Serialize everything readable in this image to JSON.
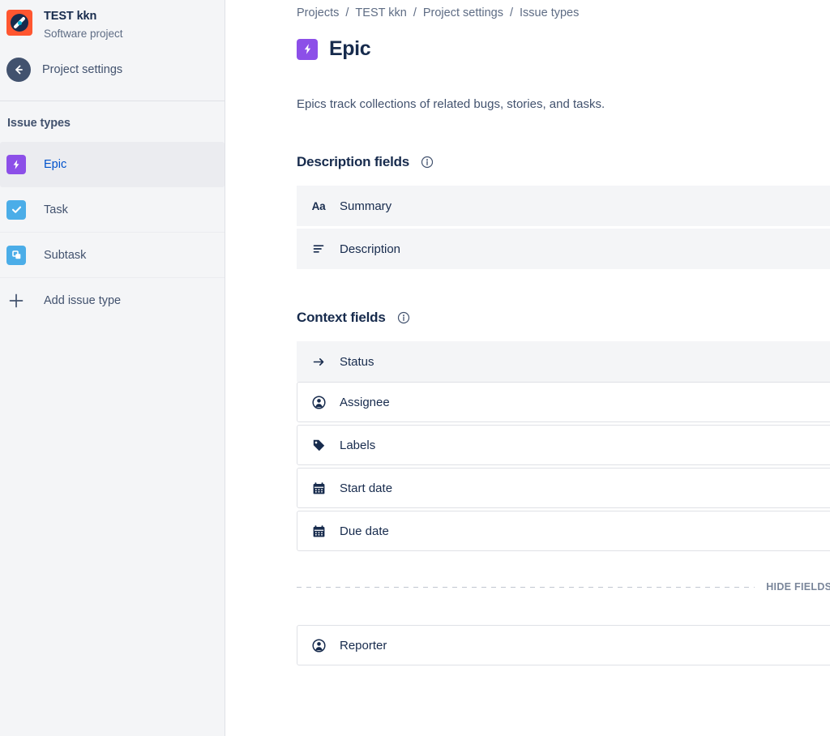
{
  "sidebar": {
    "project": {
      "name": "TEST kkn",
      "type": "Software project",
      "avatar_icon": "project-avatar-icon",
      "avatar_bg": "#FF5630"
    },
    "back_nav": {
      "label": "Project settings",
      "icon": "back-arrow-icon"
    },
    "section_title": "Issue types",
    "issue_types": [
      {
        "label": "Epic",
        "icon": "epic-bolt-icon",
        "color": "#8C4FE8",
        "selected": true
      },
      {
        "label": "Task",
        "icon": "task-check-icon",
        "color": "#4BADE8",
        "selected": false
      },
      {
        "label": "Subtask",
        "icon": "subtask-squares-icon",
        "color": "#4BADE8",
        "selected": false
      }
    ],
    "add_issue_type": {
      "label": "Add issue type",
      "icon": "plus-icon"
    }
  },
  "main": {
    "breadcrumb": [
      {
        "label": "Projects"
      },
      {
        "label": "TEST kkn"
      },
      {
        "label": "Project settings"
      },
      {
        "label": "Issue types"
      }
    ],
    "breadcrumb_separator": "/",
    "page_title": "Epic",
    "page_title_icon": "epic-bolt-icon",
    "intro": "Epics track collections of related bugs, stories, and tasks.",
    "description_fields": {
      "heading": "Description fields",
      "info_icon": "info-circle-icon",
      "rows": [
        {
          "label": "Summary",
          "icon": "text-aa-icon",
          "icon_glyph": "Aa",
          "style": "static"
        },
        {
          "label": "Description",
          "icon": "paragraph-lines-icon",
          "style": "static"
        }
      ]
    },
    "context_fields": {
      "heading": "Context fields",
      "info_icon": "info-circle-icon",
      "rows": [
        {
          "label": "Status",
          "icon": "arrow-right-icon",
          "style": "static"
        },
        {
          "label": "Assignee",
          "icon": "person-circle-icon",
          "style": "draggable"
        },
        {
          "label": "Labels",
          "icon": "tag-icon",
          "style": "draggable"
        },
        {
          "label": "Start date",
          "icon": "calendar-icon",
          "style": "draggable"
        },
        {
          "label": "Due date",
          "icon": "calendar-icon",
          "style": "draggable"
        }
      ]
    },
    "hide_fields_divider": {
      "label": "HIDE FIELDS BELO"
    },
    "hidden_fields": {
      "rows": [
        {
          "label": "Reporter",
          "icon": "person-circle-icon",
          "style": "draggable"
        }
      ]
    }
  }
}
